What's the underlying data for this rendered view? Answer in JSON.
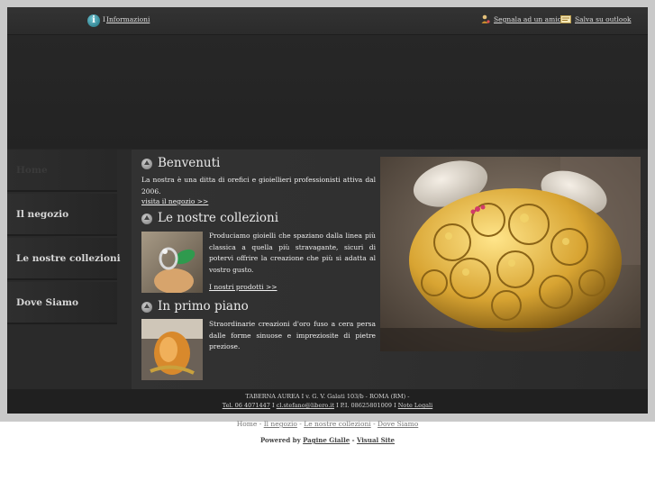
{
  "topbar": {
    "info_label": "Informazioni",
    "info_prefix": "I",
    "share_label": "Segnala ad un amico",
    "outlook_label": "Salva su outlook"
  },
  "nav": {
    "items": [
      {
        "label": "Home"
      },
      {
        "label": "Il negozio"
      },
      {
        "label": "Le nostre collezioni"
      },
      {
        "label": "Dove Siamo"
      }
    ]
  },
  "content": {
    "welcome": {
      "title": "Benvenuti",
      "text": "La nostra è una ditta di orefici e gioiellieri professionisti attiva dal 2006.",
      "link": "visita il negozio >>"
    },
    "collections": {
      "title": "Le nostre collezioni",
      "text": "Produciamo gioielli che spaziano dalla linea più classica a quella più stravagante, sicuri di potervi offrire la creazione che più si adatta al vostro gusto.",
      "link": "I nostri prodotti >>"
    },
    "featured": {
      "title": "In primo piano",
      "text": "Straordinarie creazioni d'oro fuso a cera persa dalle forme sinuose e impreziosite di pietre preziose."
    }
  },
  "footer": {
    "line1": "TABERNA AUREA I v. G. V. Galati 103/b - ROMA (RM) -",
    "tel": "Tel. 06 4071447",
    "sep1": "I",
    "email": "cl.stefano@libero.it",
    "piva": "I P.I. 08625801009 I",
    "legal": "Note Legali"
  },
  "bottom_nav": {
    "home": "Home",
    "items": [
      "Il negozio",
      "Le nostre collezioni",
      "Dove Siamo"
    ],
    "sep": "-"
  },
  "powered": {
    "prefix": "Powered by",
    "brand1": "Pagine Gialle",
    "dash": "-",
    "brand2": "Visual Site"
  }
}
